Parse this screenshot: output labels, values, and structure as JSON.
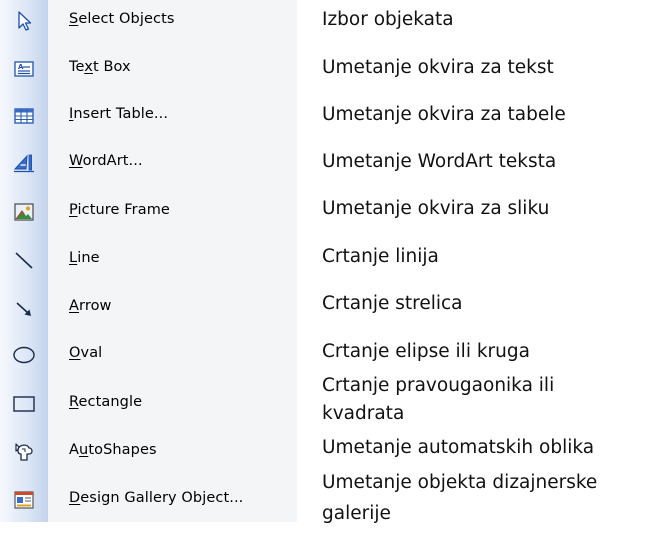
{
  "menu": {
    "items": [
      {
        "icon": "select-arrow-icon",
        "pre": "",
        "key": "S",
        "post": "elect Objects"
      },
      {
        "icon": "text-box-icon",
        "pre": "Te",
        "key": "x",
        "post": "t Box"
      },
      {
        "icon": "table-grid-icon",
        "pre": "",
        "key": "I",
        "post": "nsert Table..."
      },
      {
        "icon": "wordart-icon",
        "pre": "",
        "key": "W",
        "post": "ordArt..."
      },
      {
        "icon": "picture-frame-icon",
        "pre": "",
        "key": "P",
        "post": "icture Frame"
      },
      {
        "icon": "line-icon",
        "pre": "",
        "key": "L",
        "post": "ine"
      },
      {
        "icon": "arrow-icon",
        "pre": "",
        "key": "A",
        "post": "rrow"
      },
      {
        "icon": "oval-icon",
        "pre": "",
        "key": "O",
        "post": "val"
      },
      {
        "icon": "rectangle-icon",
        "pre": "",
        "key": "R",
        "post": "ectangle"
      },
      {
        "icon": "autoshapes-icon",
        "pre": "A",
        "key": "u",
        "post": "toShapes"
      },
      {
        "icon": "design-gallery-icon",
        "pre": "",
        "key": "D",
        "post": "esign Gallery Object..."
      }
    ]
  },
  "descriptions": [
    "Izbor objekata",
    "Umetanje okvira za tekst",
    "Umetanje okvira za tabele",
    "Umetanje WordArt teksta",
    "Umetanje okvira za sliku",
    "Crtanje linija",
    "Crtanje strelica",
    "Crtanje elipse ili kruga",
    "Crtanje pravougaonika ili",
    "kvadrata",
    "Umetanje automatskih oblika",
    "Umetanje objekta dizajnerske",
    "galerije"
  ],
  "colors": {
    "menu_bg": "#f4f5f7",
    "icon_strip": "#c4d3ec",
    "icon_blue": "#3a6cc8"
  }
}
